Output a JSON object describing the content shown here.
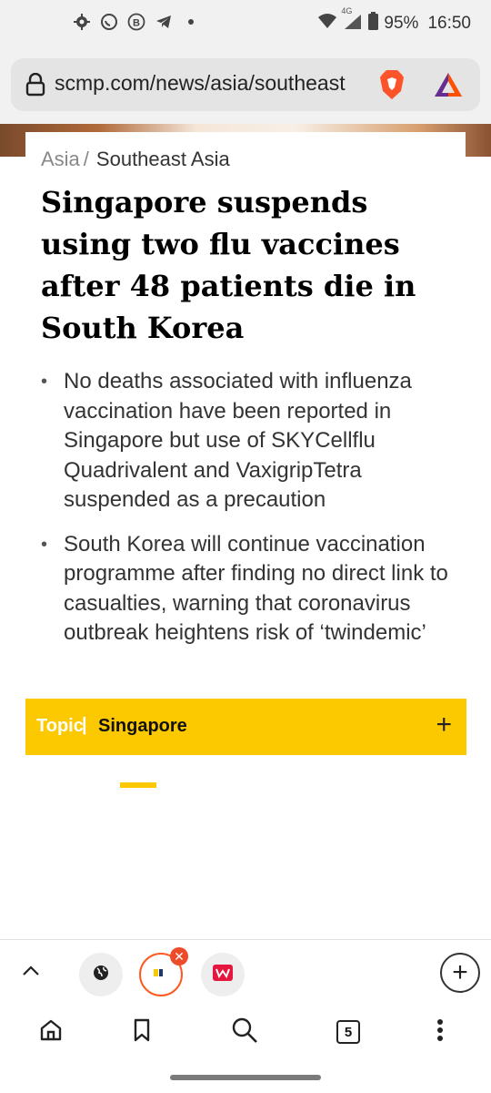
{
  "status_bar": {
    "battery": "95%",
    "time": "16:50",
    "network": "4G",
    "icons": [
      "gear-icon",
      "whatsapp-icon",
      "b-icon",
      "telegram-icon",
      "dot-icon"
    ]
  },
  "browser": {
    "url": "scmp.com/news/asia/southeast",
    "tab_count": "5"
  },
  "article": {
    "breadcrumb": {
      "parent": "Asia",
      "separator": "/",
      "current": "Southeast Asia"
    },
    "headline": "Singapore suspends using two flu vaccines after 48 patients die in South Korea",
    "bullets": [
      "No deaths associated with influenza vaccination have been reported in Singapore but use of SKYCellflu Quadrivalent and VaxigripTetra suspended as a precaution",
      "South Korea will continue vaccination programme after finding no direct link to casualties, warning that coronavirus outbreak heightens risk of ‘twindemic’"
    ],
    "topic": {
      "label": "Topic",
      "separator": "|",
      "name": "Singapore",
      "action": "+"
    }
  },
  "tab_strip": {
    "add_label": "+"
  },
  "colors": {
    "accent": "#fcc800",
    "brave": "#fb542b",
    "close_badge": "#ee4b2b"
  }
}
